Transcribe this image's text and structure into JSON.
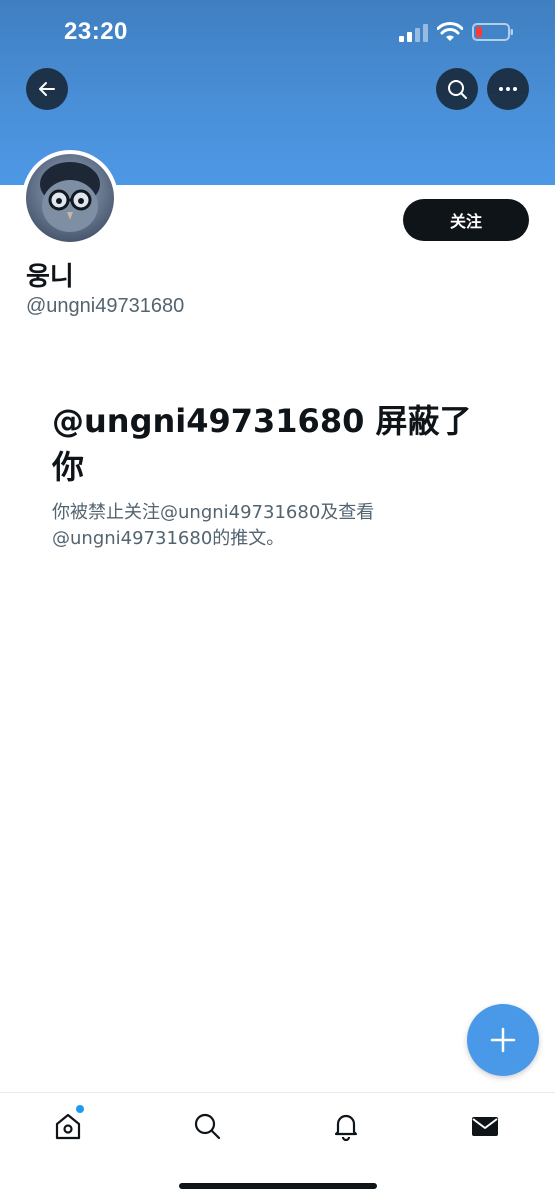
{
  "status_bar": {
    "time": "23:20"
  },
  "header": {
    "back_icon": "arrow-left-icon",
    "search_icon": "search-icon",
    "more_icon": "more-dots-icon",
    "banner_color": "#4a90d9"
  },
  "profile": {
    "display_name": "웅니",
    "handle": "@ungni49731680",
    "follow_label": "关注"
  },
  "blocked": {
    "title": "@ungni49731680 屏蔽了你",
    "description": "你被禁止关注@ungni49731680及查看@ungni49731680的推文。"
  },
  "fab": {
    "icon": "plus-icon",
    "color": "#4a99e9"
  },
  "tab_bar": {
    "items": [
      {
        "name": "home",
        "icon": "home-icon"
      },
      {
        "name": "search",
        "icon": "search-icon"
      },
      {
        "name": "notifications",
        "icon": "bell-icon"
      },
      {
        "name": "messages",
        "icon": "mail-icon"
      }
    ]
  }
}
